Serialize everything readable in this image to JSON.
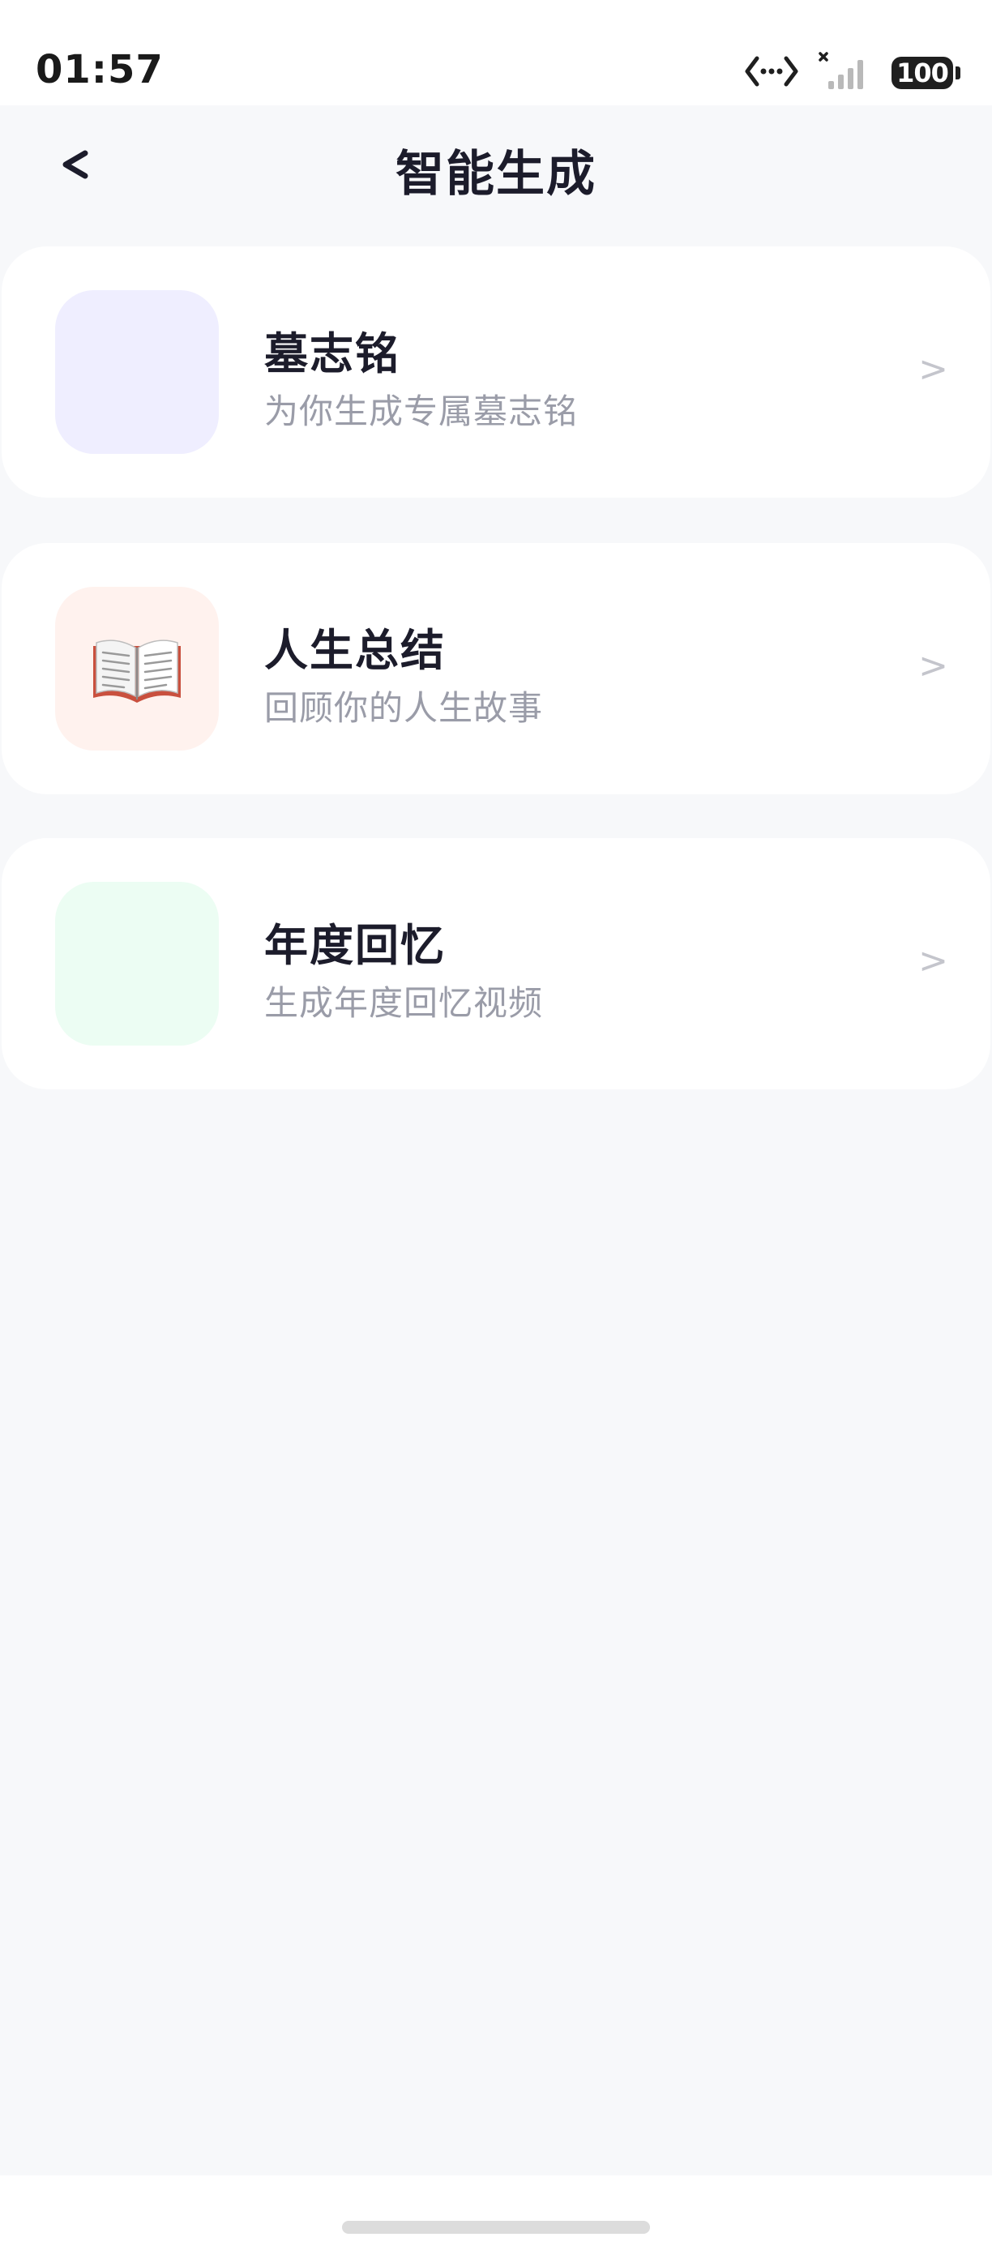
{
  "status_bar": {
    "time": "01:57",
    "battery": "100",
    "icons": [
      "data-transfer-icon",
      "signal-x-icon",
      "battery-icon"
    ]
  },
  "header": {
    "back_label": "<",
    "title": "智能生成"
  },
  "cards": [
    {
      "title": "墓志铭",
      "subtitle": "为你生成专属墓志铭",
      "arrow": ">",
      "icon_bg": "#efeeff",
      "icon": ""
    },
    {
      "title": "人生总结",
      "subtitle": "回顾你的人生故事",
      "arrow": ">",
      "icon_bg": "#fff2ee",
      "icon": "open-book-icon"
    },
    {
      "title": "年度回忆",
      "subtitle": "生成年度回忆视频",
      "arrow": ">",
      "icon_bg": "#ecfdf3",
      "icon": ""
    }
  ],
  "colors": {
    "page_bg": "#f7f8fa",
    "card_bg": "#ffffff",
    "title_text": "#1c1c2b",
    "subtitle_text": "#9a9ca8",
    "arrow": "#c4c5cc"
  }
}
